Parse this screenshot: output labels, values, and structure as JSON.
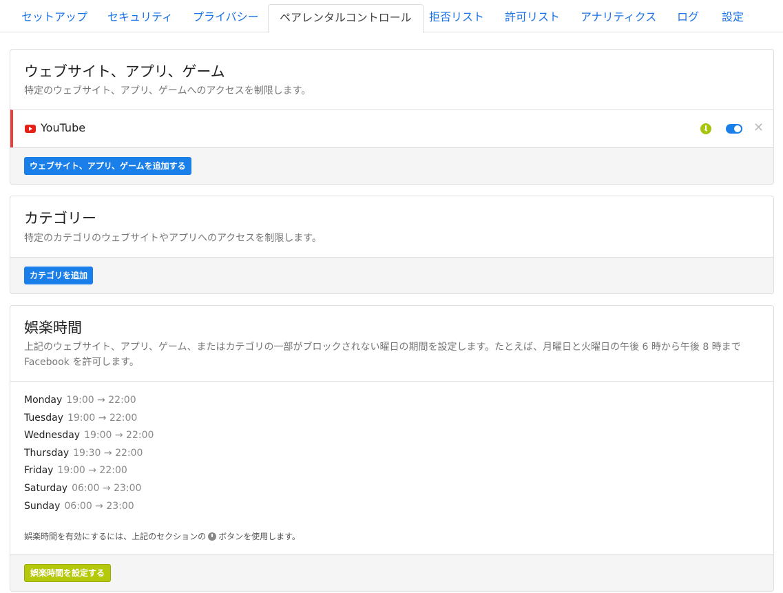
{
  "tabs": [
    {
      "label": "セットアップ"
    },
    {
      "label": "セキュリティ"
    },
    {
      "label": "プライバシー"
    },
    {
      "label": "ペアレンタルコントロール"
    },
    {
      "label": "拒否リスト"
    },
    {
      "label": "許可リスト"
    },
    {
      "label": "アナリティクス"
    },
    {
      "label": "ログ"
    },
    {
      "label": "設定"
    }
  ],
  "websites": {
    "title": "ウェブサイト、アプリ、ゲーム",
    "description": "特定のウェブサイト、アプリ、ゲームへのアクセスを制限します。",
    "items": [
      {
        "name": "YouTube",
        "icon": "youtube-icon",
        "enabled": true
      }
    ],
    "add_button": "ウェブサイト、アプリ、ゲームを追加する"
  },
  "categories": {
    "title": "カテゴリー",
    "description": "特定のカテゴリのウェブサイトやアプリへのアクセスを制限します。",
    "add_button": "カテゴリを追加"
  },
  "recreation": {
    "title": "娯楽時間",
    "description": "上記のウェブサイト、アプリ、ゲーム、またはカテゴリの一部がブロックされない曜日の期間を設定します。たとえば、月曜日と火曜日の午後 6 時から午後 8 時まで Facebook を許可します。",
    "schedule": [
      {
        "day": "Monday",
        "time": "19:00 → 22:00"
      },
      {
        "day": "Tuesday",
        "time": "19:00 → 22:00"
      },
      {
        "day": "Wednesday",
        "time": "19:00 → 22:00"
      },
      {
        "day": "Thursday",
        "time": "19:30 → 22:00"
      },
      {
        "day": "Friday",
        "time": "19:00 → 22:00"
      },
      {
        "day": "Saturday",
        "time": "06:00 → 23:00"
      },
      {
        "day": "Sunday",
        "time": "06:00 → 23:00"
      }
    ],
    "note_before": "娯楽時間を有効にするには、上記のセクションの",
    "note_after": "ボタンを使用します。",
    "set_button": "娯楽時間を設定する"
  },
  "colors": {
    "accent": "#1a7fe8",
    "link": "#1a73e8",
    "green": "#b5c80a",
    "youtube_red": "#e62117",
    "active_border": "#e8413b"
  }
}
